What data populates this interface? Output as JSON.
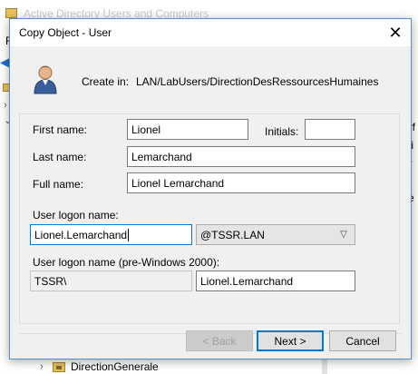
{
  "background": {
    "title": "Active Directory Users and Computers",
    "menu_first_letter": "F",
    "right_fragments": [
      "erf",
      "cti",
      "ur",
      "ite"
    ],
    "tree_bottom_item": "DirectionGenerale"
  },
  "dialog": {
    "title": "Copy Object - User",
    "close_glyph": "✕",
    "create_in_label": "Create in:",
    "create_in_path": "LAN/LabUsers/DirectionDesRessourcesHumaines",
    "fields": {
      "first_name_label": "First name:",
      "first_name_value": "Lionel",
      "initials_label": "Initials:",
      "initials_value": "",
      "last_name_label": "Last name:",
      "last_name_value": "Lemarchand",
      "full_name_label": "Full name:",
      "full_name_value": "Lionel Lemarchand",
      "logon_label": "User logon name:",
      "logon_value": "Lionel.Lemarchand",
      "domain_value": "@TSSR.LAN",
      "pre2000_label": "User logon name (pre-Windows 2000):",
      "pre2000_domain": "TSSR\\",
      "pre2000_value": "Lionel.Lemarchand"
    },
    "buttons": {
      "back": "< Back",
      "next": "Next >",
      "cancel": "Cancel"
    }
  },
  "colors": {
    "accent": "#0078d7",
    "dialog_bg": "#f0f0f0",
    "folder": "#e6c15c"
  },
  "icons": [
    "app-folder-icon",
    "back-arrow-icon",
    "user-icon",
    "close-icon",
    "chevron-down-icon",
    "folder-icon"
  ]
}
